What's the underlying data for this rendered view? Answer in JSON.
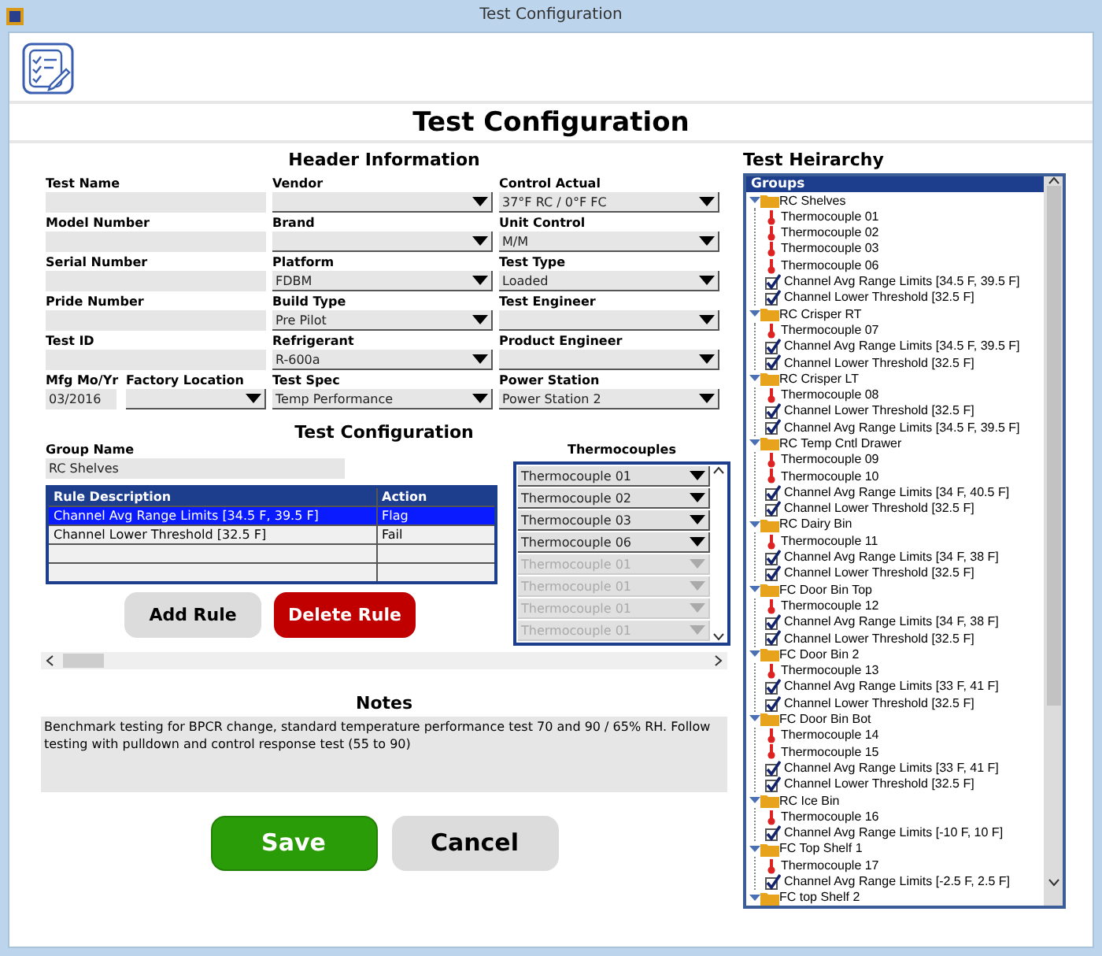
{
  "window": {
    "title": "Test Configuration"
  },
  "page_title": "Test Configuration",
  "header_info": {
    "title": "Header Information",
    "rows": [
      [
        {
          "label": "Test Name",
          "kind": "text"
        },
        {
          "label": "Vendor",
          "kind": "select"
        },
        {
          "label": "Control Actual",
          "kind": "select",
          "value": "37°F RC / 0°F FC"
        }
      ],
      [
        {
          "label": "Model Number",
          "kind": "text"
        },
        {
          "label": "Brand",
          "kind": "select"
        },
        {
          "label": "Unit Control",
          "kind": "select",
          "value": "M/M"
        }
      ],
      [
        {
          "label": "Serial Number",
          "kind": "text"
        },
        {
          "label": "Platform",
          "kind": "select",
          "value": "FDBM"
        },
        {
          "label": "Test Type",
          "kind": "select",
          "value": "Loaded"
        }
      ],
      [
        {
          "label": "Pride Number",
          "kind": "text"
        },
        {
          "label": "Build Type",
          "kind": "select",
          "value": "Pre Pilot"
        },
        {
          "label": "Test Engineer",
          "kind": "select"
        }
      ],
      [
        {
          "label": "Test ID",
          "kind": "text"
        },
        {
          "label": "Refrigerant",
          "kind": "select",
          "value": "R-600a"
        },
        {
          "label": "Product Engineer",
          "kind": "select"
        }
      ],
      [
        {
          "kind": "pair",
          "fields": [
            {
              "label": "Mfg Mo/Yr",
              "kind": "text",
              "value": "03/2016"
            },
            {
              "label": "Factory Location",
              "kind": "select"
            }
          ]
        },
        {
          "label": "Test Spec",
          "kind": "select",
          "value": "Temp Performance"
        },
        {
          "label": "Power Station",
          "kind": "select",
          "value": "Power Station 2"
        }
      ]
    ]
  },
  "test_config": {
    "title": "Test Configuration",
    "group_name": {
      "label": "Group Name",
      "value": "RC Shelves"
    },
    "rules": {
      "columns": [
        "Rule Description",
        "Action"
      ],
      "rows": [
        {
          "description": "Channel Avg Range Limits [34.5 F, 39.5 F]",
          "action": "Flag",
          "selected": true
        },
        {
          "description": "Channel Lower Threshold [32.5 F]",
          "action": "Fail",
          "selected": false
        }
      ]
    },
    "buttons": [
      {
        "label": "Add Rule",
        "kind": "secondary"
      },
      {
        "label": "Delete Rule",
        "kind": "danger"
      }
    ],
    "thermocouples": {
      "label": "Thermocouples",
      "items": [
        {
          "value": "Thermocouple 01",
          "disabled": false
        },
        {
          "value": "Thermocouple 02",
          "disabled": false
        },
        {
          "value": "Thermocouple 03",
          "disabled": false
        },
        {
          "value": "Thermocouple 06",
          "disabled": false
        },
        {
          "value": "Thermocouple 01",
          "disabled": true
        },
        {
          "value": "Thermocouple 01",
          "disabled": true
        },
        {
          "value": "Thermocouple 01",
          "disabled": true
        },
        {
          "value": "Thermocouple 01",
          "disabled": true
        }
      ]
    }
  },
  "notes": {
    "title": "Notes",
    "text": "Benchmark testing for BPCR change, standard temperature performance test 70 and 90 / 65% RH. Follow testing with pulldown and control response test (55 to 90)"
  },
  "actions": [
    {
      "label": "Save",
      "kind": "primary"
    },
    {
      "label": "Cancel",
      "kind": "secondary"
    }
  ],
  "hierarchy": {
    "title": "Test Heirarchy",
    "header": "Groups",
    "groups": [
      {
        "label": "RC Shelves",
        "expanded": true,
        "children": [
          {
            "kind": "thermocouple",
            "label": "Thermocouple 01"
          },
          {
            "kind": "thermocouple",
            "label": "Thermocouple 02"
          },
          {
            "kind": "thermocouple",
            "label": "Thermocouple 03"
          },
          {
            "kind": "thermocouple",
            "label": "Thermocouple 06"
          },
          {
            "kind": "rule",
            "label": "Channel Avg Range Limits [34.5 F, 39.5 F]"
          },
          {
            "kind": "rule",
            "label": "Channel Lower Threshold [32.5 F]"
          }
        ]
      },
      {
        "label": "RC Crisper RT",
        "expanded": true,
        "children": [
          {
            "kind": "thermocouple",
            "label": "Thermocouple 07"
          },
          {
            "kind": "rule",
            "label": "Channel Avg Range Limits [34.5 F, 39.5 F]"
          },
          {
            "kind": "rule",
            "label": "Channel Lower Threshold [32.5 F]"
          }
        ]
      },
      {
        "label": "RC Crisper LT",
        "expanded": true,
        "children": [
          {
            "kind": "thermocouple",
            "label": "Thermocouple 08"
          },
          {
            "kind": "rule",
            "label": "Channel Lower Threshold [32.5 F]"
          },
          {
            "kind": "rule",
            "label": "Channel Avg Range Limits [34.5 F, 39.5 F]"
          }
        ]
      },
      {
        "label": "RC Temp Cntl Drawer",
        "expanded": true,
        "children": [
          {
            "kind": "thermocouple",
            "label": "Thermocouple 09"
          },
          {
            "kind": "thermocouple",
            "label": "Thermocouple 10"
          },
          {
            "kind": "rule",
            "label": "Channel Avg Range Limits [34 F, 40.5 F]"
          },
          {
            "kind": "rule",
            "label": "Channel Lower Threshold [32.5 F]"
          }
        ]
      },
      {
        "label": "RC Dairy Bin",
        "expanded": true,
        "children": [
          {
            "kind": "thermocouple",
            "label": "Thermocouple 11"
          },
          {
            "kind": "rule",
            "label": "Channel Avg Range Limits [34 F, 38 F]"
          },
          {
            "kind": "rule",
            "label": "Channel Lower Threshold [32.5 F]"
          }
        ]
      },
      {
        "label": "FC Door Bin Top",
        "expanded": true,
        "children": [
          {
            "kind": "thermocouple",
            "label": "Thermocouple 12"
          },
          {
            "kind": "rule",
            "label": "Channel Avg Range Limits [34 F, 38 F]"
          },
          {
            "kind": "rule",
            "label": "Channel Lower Threshold [32.5 F]"
          }
        ]
      },
      {
        "label": "FC Door Bin 2",
        "expanded": true,
        "children": [
          {
            "kind": "thermocouple",
            "label": "Thermocouple 13"
          },
          {
            "kind": "rule",
            "label": "Channel Avg Range Limits [33 F, 41 F]"
          },
          {
            "kind": "rule",
            "label": "Channel Lower Threshold [32.5 F]"
          }
        ]
      },
      {
        "label": "FC Door Bin Bot",
        "expanded": true,
        "children": [
          {
            "kind": "thermocouple",
            "label": "Thermocouple 14"
          },
          {
            "kind": "thermocouple",
            "label": "Thermocouple 15"
          },
          {
            "kind": "rule",
            "label": "Channel Avg Range Limits [33 F, 41 F]"
          },
          {
            "kind": "rule",
            "label": "Channel Lower Threshold [32.5 F]"
          }
        ]
      },
      {
        "label": "RC Ice Bin",
        "expanded": true,
        "children": [
          {
            "kind": "thermocouple",
            "label": "Thermocouple 16"
          },
          {
            "kind": "rule",
            "label": "Channel Avg Range Limits [-10 F, 10 F]"
          }
        ]
      },
      {
        "label": "FC Top Shelf 1",
        "expanded": true,
        "children": [
          {
            "kind": "thermocouple",
            "label": "Thermocouple 17"
          },
          {
            "kind": "rule",
            "label": "Channel Avg Range Limits [-2.5 F, 2.5 F]"
          }
        ]
      },
      {
        "label": "FC top Shelf 2",
        "expanded": true
      }
    ]
  }
}
